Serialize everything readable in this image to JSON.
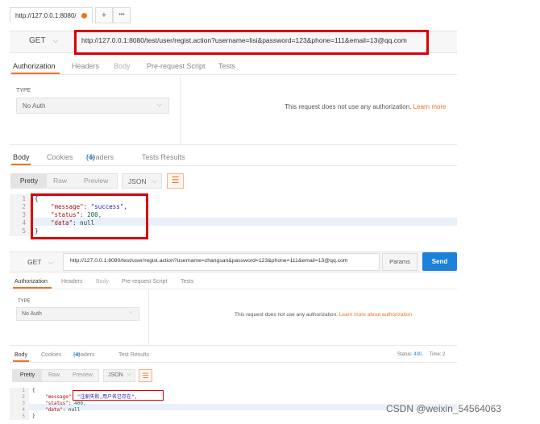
{
  "browser": {
    "tab_url": "http://127.0.0.1:8080/",
    "plus_label": "+",
    "more_label": "•••"
  },
  "request1": {
    "method": "GET",
    "url": "http://127.0.0.1:8080/test/user/regist.action?username=lisi&password=123&phone=111&email=13@qq.com",
    "tabs": [
      "Authorization",
      "Headers",
      "Body",
      "Pre-request Script",
      "Tests"
    ],
    "auth_type_label": "TYPE",
    "auth_type_value": "No Auth",
    "auth_message": "This request does not use any authorization.",
    "auth_link": "Learn more"
  },
  "response1": {
    "tabs": [
      "Body",
      "Cookies",
      "Headers",
      "Tests Results"
    ],
    "headers_count": "(4)",
    "view_modes": [
      "Pretty",
      "Raw",
      "Preview"
    ],
    "format": "JSON",
    "lines": [
      "1",
      "2",
      "3",
      "4",
      "5"
    ],
    "open_brace": "{",
    "close_brace": "}",
    "message_key": "\"message\"",
    "message_value": "\"success\",",
    "status_key": "\"status\"",
    "status_value": "200,",
    "data_key": "\"data\"",
    "data_value": "null"
  },
  "request2": {
    "method": "GET",
    "url": "http://127.0.0.1:8080/test/user/regist.action?username=zhangsan&password=123&phone=111&email=13@qq.com",
    "params_label": "Params",
    "send_label": "Send",
    "tabs": [
      "Authorization",
      "Headers",
      "Body",
      "Pre-request Script",
      "Tests"
    ],
    "auth_type_label": "TYPE",
    "auth_type_value": "No Auth",
    "auth_message": "This request does not use any authorization.",
    "auth_link": "Learn more about authorization"
  },
  "response2": {
    "tabs": [
      "Body",
      "Cookies",
      "Headers",
      "Test Results"
    ],
    "headers_count": "(4)",
    "status_label": "Status:",
    "status_value": "400,",
    "time_label": "Time: 2",
    "view_modes": [
      "Pretty",
      "Raw",
      "Preview"
    ],
    "format": "JSON",
    "lines": [
      "1",
      "2",
      "3",
      "4",
      "5"
    ],
    "open_brace": "{",
    "close_brace": "}",
    "message_key": "\"message\"",
    "message_value": "\"注册失败,用户名已存在\",",
    "status_key": "\"status\"",
    "data_key": "\"data\"",
    "data_value": "null"
  },
  "watermark": "CSDN @weixin_54564063"
}
